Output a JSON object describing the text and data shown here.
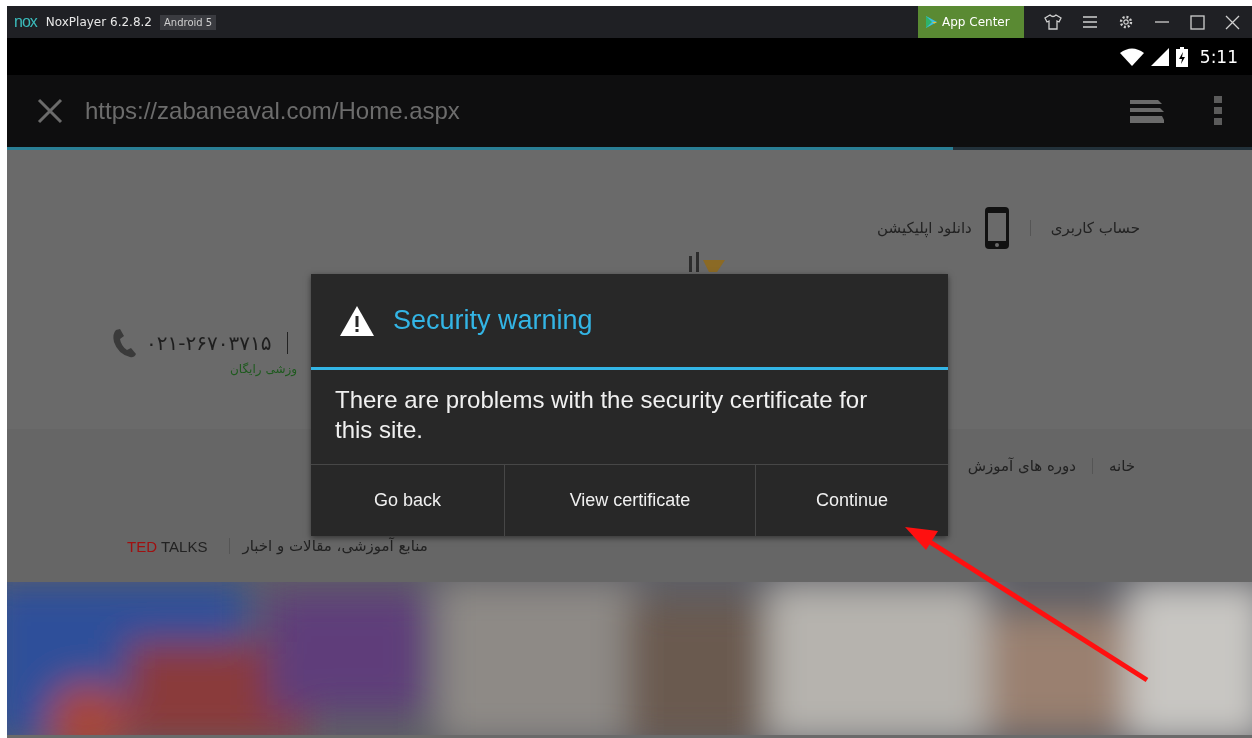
{
  "titlebar": {
    "logo": "nox",
    "title": "NoxPlayer 6.2.8.2",
    "badge": "Android 5",
    "app_center": "App Center"
  },
  "status_bar": {
    "time": "5:11"
  },
  "browser": {
    "url": "https://zabaneaval.com/Home.aspx",
    "progress": {
      "level": 0.76
    }
  },
  "page": {
    "header_links": [
      "حساب کاربری",
      "دانلود اپلیکیشن"
    ],
    "phone": "۰۲۱-۲۶۷۰۳۷۱۵",
    "tagline": "وزشی رایگان",
    "nav": [
      "خانه",
      "دوره های آموزش"
    ],
    "resources": "منابع آموزشی، مقالات و اخبار",
    "ted": "TED",
    "talks": "TALKS"
  },
  "dialog": {
    "title": "Security warning",
    "message": "There are problems with the security certificate for this site.",
    "go_back_button": "Go back",
    "view_certificate_button": "View certificate",
    "continue_button": "Continue"
  }
}
